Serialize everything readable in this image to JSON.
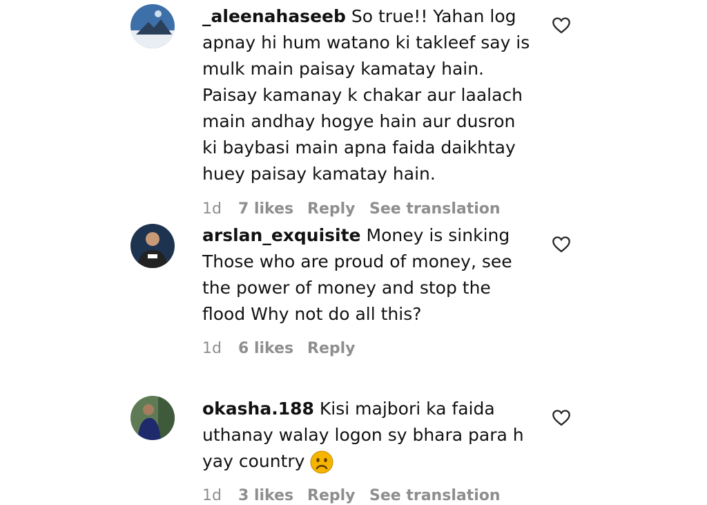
{
  "comments": [
    {
      "username": "_aleenahaseeb",
      "text": "So true!! Yahan log apnay hi hum watano ki takleef say is mulk main paisay kamatay hain. Paisay kamanay k chakar aur laalach main andhay hogye hain aur dusron ki baybasi main apna faida daikhtay huey paisay kamatay hain.",
      "time": "1d",
      "likes": "7 likes",
      "reply": "Reply",
      "translate": "See translation"
    },
    {
      "username": "arslan_exquisite",
      "text": "Money is sinking Those who are proud of money, see the power of money and stop the flood Why not do all this?",
      "time": "1d",
      "likes": "6 likes",
      "reply": "Reply",
      "translate": ""
    },
    {
      "username": "okasha.188",
      "text": "Kisi majbori ka faida uthanay walay logon sy bhara para h yay country",
      "emoji": "sad-face",
      "time": "1d",
      "likes": "3 likes",
      "reply": "Reply",
      "translate": "See translation"
    }
  ],
  "icons": {
    "like": "heart-outline-icon",
    "avatar_placeholder": "avatar"
  },
  "colors": {
    "text": "#111111",
    "meta": "#8e8e8e",
    "emoji": "#f4b400"
  }
}
